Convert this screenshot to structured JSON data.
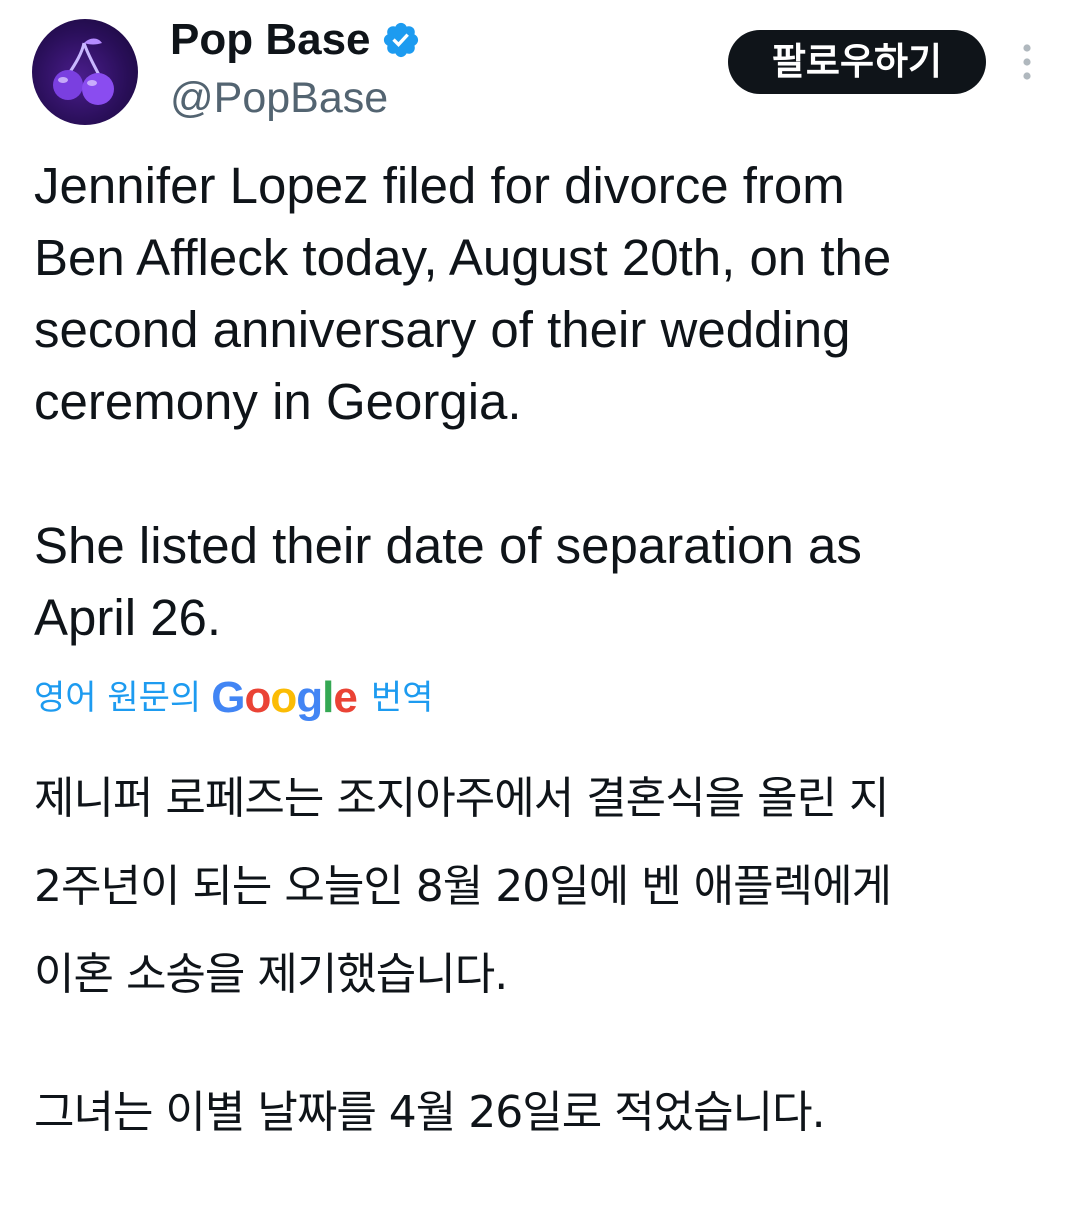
{
  "author": {
    "display_name": "Pop Base",
    "handle": "@PopBase",
    "verified": true,
    "avatar_icon": "cherry-avatar-icon"
  },
  "actions": {
    "follow_label": "팔로우하기",
    "more_icon": "more-vertical-icon"
  },
  "tweet": {
    "paragraph_1": "Jennifer Lopez filed for divorce from\nBen Affleck today, August 20th, on the\nsecond anniversary of their wedding\nceremony in Georgia.",
    "paragraph_2": "She listed their date of separation as\nApril 26."
  },
  "translation": {
    "prefix": "영어 원문의",
    "brand": "Google",
    "suffix": "번역",
    "paragraph_1": "제니퍼 로페즈는 조지아주에서 결혼식을 올린 지\n2주년이 되는 오늘인 8월 20일에 벤 애플렉에게\n이혼 소송을 제기했습니다.",
    "paragraph_2": "그녀는 이별 날짜를 4월 26일로 적었습니다."
  },
  "colors": {
    "text": "#0f1419",
    "secondary": "#536471",
    "link": "#1d9bf0",
    "verified": "#1d9bf0",
    "button_bg": "#0f1419"
  }
}
